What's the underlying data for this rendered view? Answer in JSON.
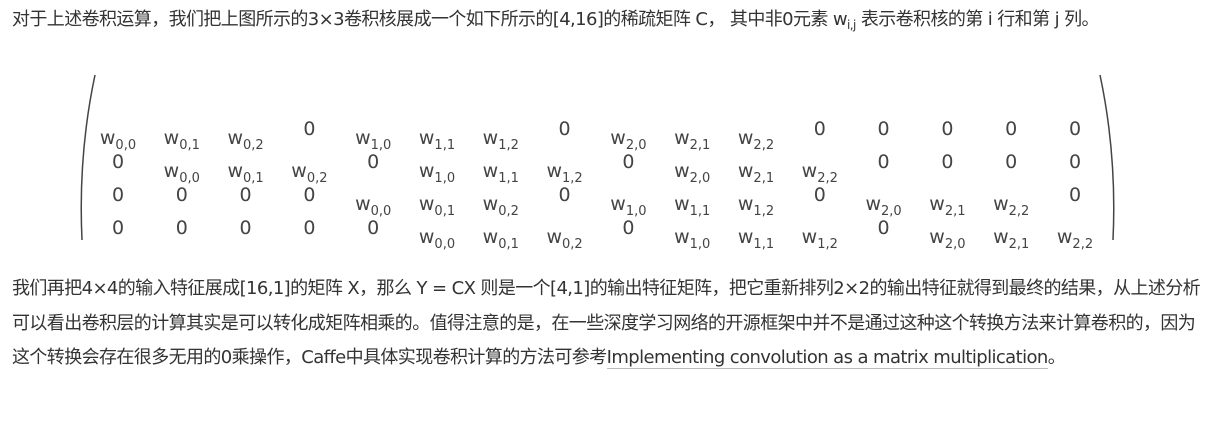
{
  "paragraph1": {
    "before": "对于上述卷积运算，我们把上图所示的3×3卷积核展成一个如下所示的[4,16]的稀疏矩阵 C， 其中非0元素 ",
    "symbol": "w",
    "symbol_sub": "i,j",
    "after": " 表示卷积核的第 i 行和第 j 列。"
  },
  "matrix": [
    [
      "w0,0",
      "w0,1",
      "w0,2",
      "0",
      "w1,0",
      "w1,1",
      "w1,2",
      "0",
      "w2,0",
      "w2,1",
      "w2,2",
      "0",
      "0",
      "0",
      "0",
      "0"
    ],
    [
      "0",
      "w0,0",
      "w0,1",
      "w0,2",
      "0",
      "w1,0",
      "w1,1",
      "w1,2",
      "0",
      "w2,0",
      "w2,1",
      "w2,2",
      "0",
      "0",
      "0",
      "0"
    ],
    [
      "0",
      "0",
      "0",
      "0",
      "w0,0",
      "w0,1",
      "w0,2",
      "0",
      "w1,0",
      "w1,1",
      "w1,2",
      "0",
      "w2,0",
      "w2,1",
      "w2,2",
      "0"
    ],
    [
      "0",
      "0",
      "0",
      "0",
      "0",
      "w0,0",
      "w0,1",
      "w0,2",
      "0",
      "w1,0",
      "w1,1",
      "w1,2",
      "0",
      "w2,0",
      "w2,1",
      "w2,2"
    ]
  ],
  "paragraph2": {
    "before": "我们再把4×4的输入特征展成[16,1]的矩阵 X，那么 Y = CX 则是一个[4,1]的输出特征矩阵，把它重新排列2×2的输出特征就得到最终的结果，从上述分析可以看出卷积层的计算其实是可以转化成矩阵相乘的。值得注意的是，在一些深度学习网络的开源框架中并不是通过这种这个转换方法来计算卷积的，因为这个转换会存在很多无用的0乘操作，Caffe中具体实现卷积计算的方法可参考",
    "link": "Implementing convolution as a matrix multiplication",
    "after": "。"
  }
}
